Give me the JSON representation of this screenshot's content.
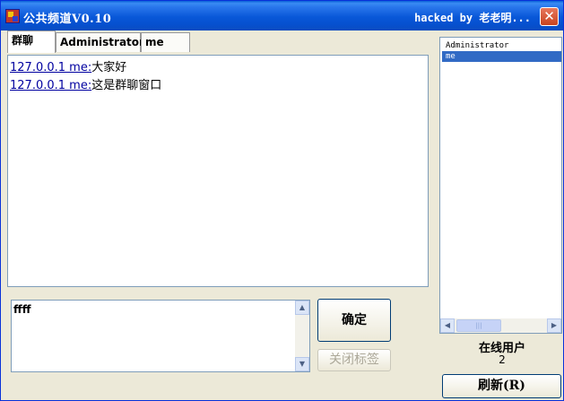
{
  "window": {
    "title": "公共频道V0.10",
    "title_right": "hacked by 老老明...",
    "close_icon": "close-icon"
  },
  "tabs": [
    {
      "label": "群聊",
      "active": true
    },
    {
      "label": "Administrator",
      "active": false
    },
    {
      "label": "me",
      "active": false
    }
  ],
  "messages": [
    {
      "sender": "127.0.0.1 me:",
      "text": "大家好"
    },
    {
      "sender": "127.0.0.1 me:",
      "text": "这是群聊窗口"
    }
  ],
  "input": {
    "value": "ffff"
  },
  "buttons": {
    "confirm": "确定",
    "close_tab": "关闭标签",
    "refresh": "刷新(R)"
  },
  "users": [
    {
      "name": "Administrator",
      "selected": false
    },
    {
      "name": "me",
      "selected": true
    }
  ],
  "online": {
    "label": "在线用户",
    "count": "2"
  },
  "colors": {
    "titlebar": "#0857d8",
    "selection": "#316ac5",
    "link": "#0000a0"
  }
}
